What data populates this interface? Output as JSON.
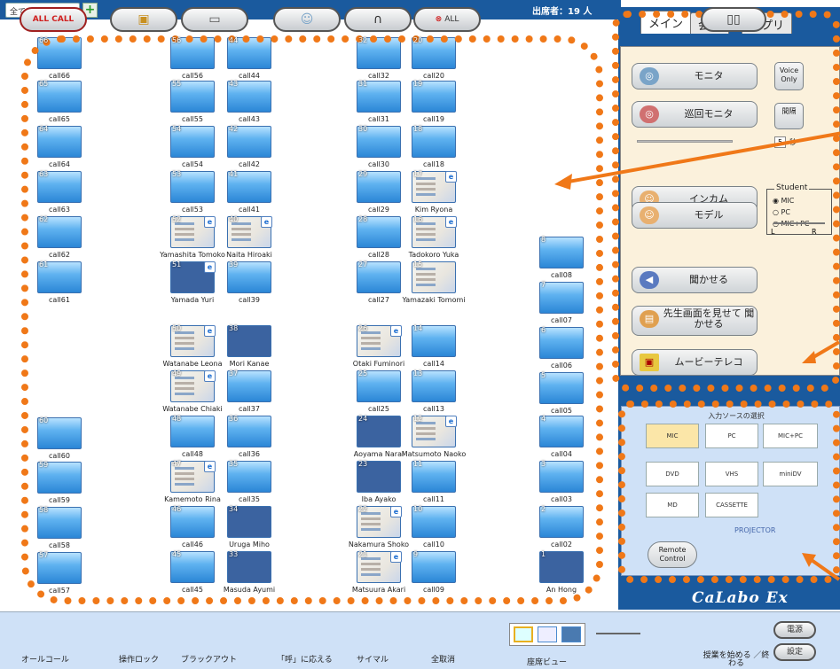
{
  "topbar": {
    "dropdown": "全て",
    "add_label": "+",
    "attendance": "出席者：19 人"
  },
  "seats": [
    {
      "num": "66",
      "label": "call66",
      "style": "blue"
    },
    {
      "num": "65",
      "label": "call65",
      "style": "blue"
    },
    {
      "num": "64",
      "label": "call64",
      "style": "blue"
    },
    {
      "num": "63",
      "label": "call63",
      "style": "blue"
    },
    {
      "num": "62",
      "label": "call62",
      "style": "blue"
    },
    {
      "num": "61",
      "label": "call61",
      "style": "blue"
    },
    {
      "num": "60",
      "label": "call60",
      "style": "blue"
    },
    {
      "num": "59",
      "label": "call59",
      "style": "blue"
    },
    {
      "num": "58",
      "label": "call58",
      "style": "blue"
    },
    {
      "num": "57",
      "label": "call57",
      "style": "blue"
    },
    {
      "num": "56",
      "label": "call56",
      "style": "blue"
    },
    {
      "num": "55",
      "label": "call55",
      "style": "blue"
    },
    {
      "num": "54",
      "label": "call54",
      "style": "blue"
    },
    {
      "num": "53",
      "label": "call53",
      "style": "blue"
    },
    {
      "num": "52",
      "label": "Yamashita Tomoko",
      "style": "shot",
      "ie": true
    },
    {
      "num": "51",
      "label": "Yamada Yuri",
      "style": "dark",
      "ie": true
    },
    {
      "num": "50",
      "label": "Watanabe Leona",
      "style": "shot",
      "ie": true
    },
    {
      "num": "49",
      "label": "Watanabe Chiaki",
      "style": "shot",
      "ie": true
    },
    {
      "num": "48",
      "label": "call48",
      "style": "blue"
    },
    {
      "num": "47",
      "label": "Kamemoto Rina",
      "style": "shot",
      "ie": true
    },
    {
      "num": "46",
      "label": "call46",
      "style": "blue"
    },
    {
      "num": "45",
      "label": "call45",
      "style": "blue"
    },
    {
      "num": "44",
      "label": "call44",
      "style": "blue"
    },
    {
      "num": "43",
      "label": "call43",
      "style": "blue"
    },
    {
      "num": "42",
      "label": "call42",
      "style": "blue"
    },
    {
      "num": "41",
      "label": "call41",
      "style": "blue"
    },
    {
      "num": "40",
      "label": "Naita Hiroaki",
      "style": "shot",
      "ie": true
    },
    {
      "num": "39",
      "label": "call39",
      "style": "blue"
    },
    {
      "num": "38",
      "label": "Mori Kanae",
      "style": "dark"
    },
    {
      "num": "37",
      "label": "call37",
      "style": "blue"
    },
    {
      "num": "36",
      "label": "call36",
      "style": "blue"
    },
    {
      "num": "35",
      "label": "call35",
      "style": "blue"
    },
    {
      "num": "34",
      "label": "Uruga Miho",
      "style": "dark"
    },
    {
      "num": "33",
      "label": "Masuda Ayumi",
      "style": "dark"
    },
    {
      "num": "32",
      "label": "call32",
      "style": "blue"
    },
    {
      "num": "31",
      "label": "call31",
      "style": "blue"
    },
    {
      "num": "30",
      "label": "call30",
      "style": "blue"
    },
    {
      "num": "29",
      "label": "call29",
      "style": "blue"
    },
    {
      "num": "28",
      "label": "call28",
      "style": "blue"
    },
    {
      "num": "27",
      "label": "call27",
      "style": "blue"
    },
    {
      "num": "26",
      "label": "Otaki Fuminori",
      "style": "shot",
      "ie": true
    },
    {
      "num": "25",
      "label": "call25",
      "style": "blue"
    },
    {
      "num": "24",
      "label": "Aoyama Narai",
      "style": "dark"
    },
    {
      "num": "23",
      "label": "Iba Ayako",
      "style": "dark"
    },
    {
      "num": "22",
      "label": "Nakamura Shoko",
      "style": "shot",
      "ie": true
    },
    {
      "num": "21",
      "label": "Matsuura Akari",
      "style": "shot",
      "ie": true
    },
    {
      "num": "20",
      "label": "call20",
      "style": "blue"
    },
    {
      "num": "19",
      "label": "call19",
      "style": "blue"
    },
    {
      "num": "18",
      "label": "call18",
      "style": "blue"
    },
    {
      "num": "17",
      "label": "Kim Ryona",
      "style": "shot",
      "ie": true
    },
    {
      "num": "16",
      "label": "Tadokoro Yuka",
      "style": "shot",
      "ie": true
    },
    {
      "num": "15",
      "label": "Yamazaki Tomomi",
      "style": "shot"
    },
    {
      "num": "14",
      "label": "call14",
      "style": "blue"
    },
    {
      "num": "13",
      "label": "call13",
      "style": "blue"
    },
    {
      "num": "12",
      "label": "Matsumoto Naoko",
      "style": "shot",
      "ie": true
    },
    {
      "num": "11",
      "label": "call11",
      "style": "blue"
    },
    {
      "num": "10",
      "label": "call10",
      "style": "blue"
    },
    {
      "num": "9",
      "label": "call09",
      "style": "blue"
    },
    {
      "num": "8",
      "label": "call08",
      "style": "blue"
    },
    {
      "num": "7",
      "label": "call07",
      "style": "blue"
    },
    {
      "num": "6",
      "label": "call06",
      "style": "blue"
    },
    {
      "num": "5",
      "label": "call05",
      "style": "blue"
    },
    {
      "num": "4",
      "label": "call04",
      "style": "blue"
    },
    {
      "num": "3",
      "label": "call03",
      "style": "blue"
    },
    {
      "num": "2",
      "label": "call02",
      "style": "blue"
    },
    {
      "num": "1",
      "label": "An Hong",
      "style": "dark"
    }
  ],
  "tabs": {
    "main": "メイン",
    "talk": "会話",
    "app": "アプリ"
  },
  "main_panel": {
    "monitor": "モニタ",
    "voice_only": "Voice Only",
    "patrol": "巡回モニタ",
    "interval": "間隔",
    "seconds_value": "5",
    "seconds_unit": "秒",
    "intercom": "インカム",
    "model": "モデル",
    "student_legend": "Student",
    "opt_mic": "MIC",
    "opt_pc": "PC",
    "opt_micpc": "MIC+PC",
    "slider_l": "L",
    "slider_r": "R",
    "let_hear": "聞かせる",
    "show_teacher": "先生画面を見せて 聞かせる",
    "movie": "ムービーテレコ"
  },
  "input_panel": {
    "title": "入力ソースの選択",
    "sources": [
      "MIC",
      "PC",
      "MIC+PC",
      "DVD",
      "VHS",
      "miniDV",
      "MD",
      "CASSETTE"
    ],
    "projector": "PROJECTOR",
    "remote": "Remote Control"
  },
  "logo": "CaLabo Ex",
  "bottom": {
    "allcall_btn": "ALL CALL",
    "allcall": "オールコール",
    "lock": "操作ロック",
    "blackout": "ブラックアウト",
    "respond": "「呼」に応える",
    "simul": "サイマル",
    "cancel_btn": "ALL",
    "cancel": "全取消",
    "seatview": "座席ビュー",
    "lesson": "授業を始める ／終わる",
    "power": "電源",
    "settings": "設定"
  },
  "colors": {
    "accent_orange": "#f07818",
    "panel_blue": "#1a5a9e",
    "panel_cream": "#fbf1dc"
  }
}
